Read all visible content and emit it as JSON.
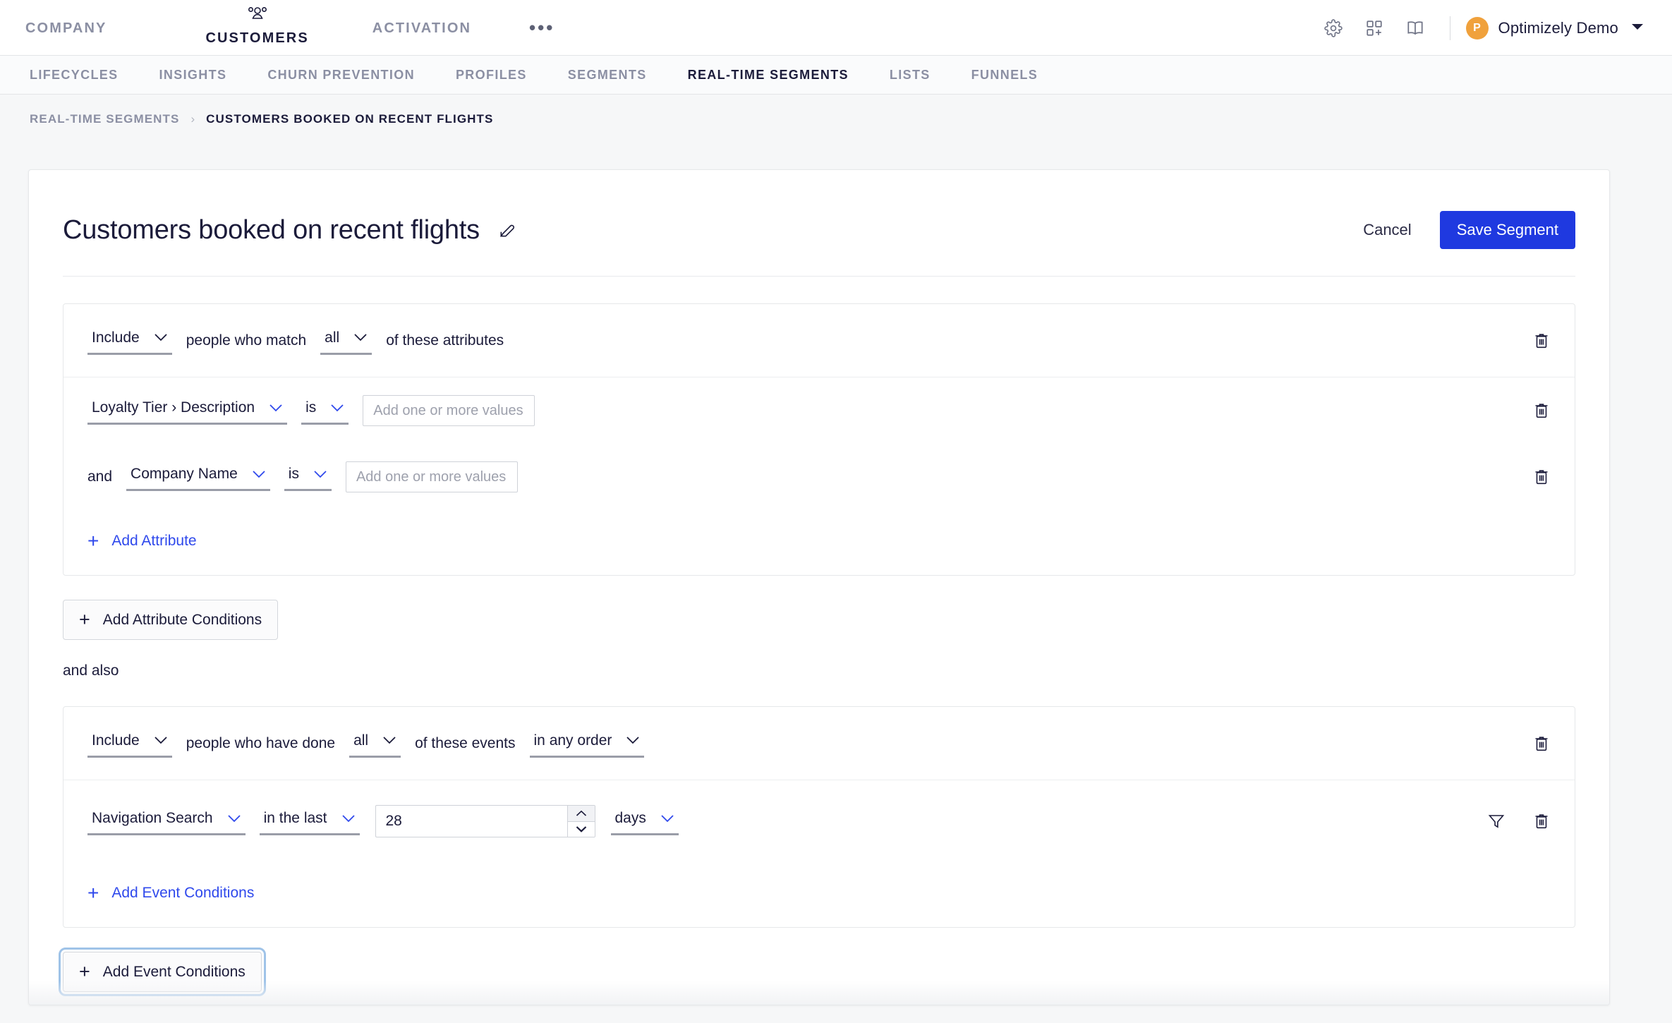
{
  "topnav": {
    "brands": [
      {
        "label": "COMPANY",
        "icon": "",
        "active": false
      },
      {
        "label": "CUSTOMERS",
        "icon": "people-icon",
        "active": true
      },
      {
        "label": "ACTIVATION",
        "icon": "",
        "active": false
      },
      {
        "label": "•••",
        "icon": "ellipsis-icon",
        "active": false
      }
    ],
    "icons": [
      "gear-icon",
      "app-add-icon",
      "book-icon"
    ],
    "account": {
      "initial": "P",
      "name": "Optimizely Demo"
    }
  },
  "subnav": {
    "items": [
      {
        "label": "LIFECYCLES",
        "active": false
      },
      {
        "label": "INSIGHTS",
        "active": false
      },
      {
        "label": "CHURN PREVENTION",
        "active": false
      },
      {
        "label": "PROFILES",
        "active": false
      },
      {
        "label": "SEGMENTS",
        "active": false
      },
      {
        "label": "REAL-TIME SEGMENTS",
        "active": true
      },
      {
        "label": "LISTS",
        "active": false
      },
      {
        "label": "FUNNELS",
        "active": false
      }
    ]
  },
  "breadcrumb": {
    "parent": "REAL-TIME SEGMENTS",
    "separator": "›",
    "current": "CUSTOMERS BOOKED ON RECENT FLIGHTS"
  },
  "header": {
    "title": "Customers booked on recent flights",
    "edit_icon": "pencil-edit-icon",
    "cancel_label": "Cancel",
    "save_label": "Save Segment",
    "save_color": "#1f39e0"
  },
  "attribute_group": {
    "header": {
      "include_select": "Include",
      "text_1": "people who match",
      "match_select": "all",
      "text_2": "of these attributes"
    },
    "rows": [
      {
        "conjunction": "",
        "attribute": "Loyalty Tier › Description",
        "operator": "is",
        "value": "",
        "value_placeholder": "Add one or more values"
      },
      {
        "conjunction": "and",
        "attribute": "Company Name",
        "operator": "is",
        "value": "",
        "value_placeholder": "Add one or more values"
      }
    ],
    "add_link": "Add Attribute"
  },
  "add_attribute_conditions_button": "Add Attribute Conditions",
  "and_also": "and also",
  "event_group": {
    "header": {
      "include_select": "Include",
      "text_1": "people who have done",
      "match_select": "all",
      "text_2": "of these events",
      "order_select": "in any order"
    },
    "rows": [
      {
        "event": "Navigation Search",
        "timeframe": "in the last",
        "amount": "28",
        "unit": "days",
        "filter_icon": "funnel-filter-icon",
        "delete_icon": "trash-icon"
      }
    ],
    "add_link": "Add Event Conditions"
  },
  "add_event_conditions_button": "Add Event Conditions",
  "icons": {
    "trash": "trash-icon",
    "plus": "+"
  }
}
